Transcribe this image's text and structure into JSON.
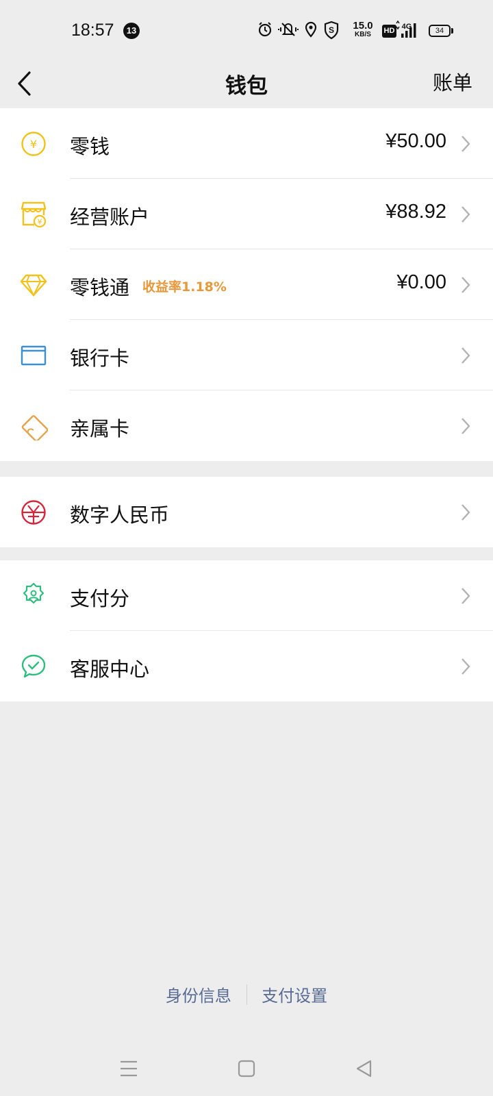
{
  "status_bar": {
    "time": "18:57",
    "notification_count": "13",
    "net_speed_value": "15.0",
    "net_speed_unit": "KB/S",
    "hd_label": "HD",
    "network_label": "4G",
    "battery": "34"
  },
  "header": {
    "title": "钱包",
    "right_action": "账单"
  },
  "groups": [
    {
      "items": [
        {
          "label": "零钱",
          "amount": "¥50.00",
          "icon": "yuan-coin-icon",
          "color": "#f2c11a"
        },
        {
          "label": "经营账户",
          "amount": "¥88.92",
          "icon": "store-icon",
          "color": "#f2c11a"
        },
        {
          "label": "零钱通",
          "tag": "收益率1.18%",
          "amount": "¥0.00",
          "icon": "diamond-icon",
          "color": "#f2c11a"
        },
        {
          "label": "银行卡",
          "icon": "bank-card-icon",
          "color": "#3c8fd6"
        },
        {
          "label": "亲属卡",
          "icon": "family-card-icon",
          "color": "#e8a24a"
        }
      ]
    },
    {
      "items": [
        {
          "label": "数字人民币",
          "icon": "digital-rmb-icon",
          "color": "#d6243b"
        }
      ]
    },
    {
      "items": [
        {
          "label": "支付分",
          "icon": "pay-score-icon",
          "color": "#2dbd7e"
        },
        {
          "label": "客服中心",
          "icon": "customer-service-icon",
          "color": "#2dbd7e"
        }
      ]
    }
  ],
  "footer": {
    "link_identity": "身份信息",
    "link_settings": "支付设置",
    "link_color": "#576b95"
  },
  "system_nav": [
    "menu-icon",
    "home-icon",
    "back-triangle-icon"
  ]
}
